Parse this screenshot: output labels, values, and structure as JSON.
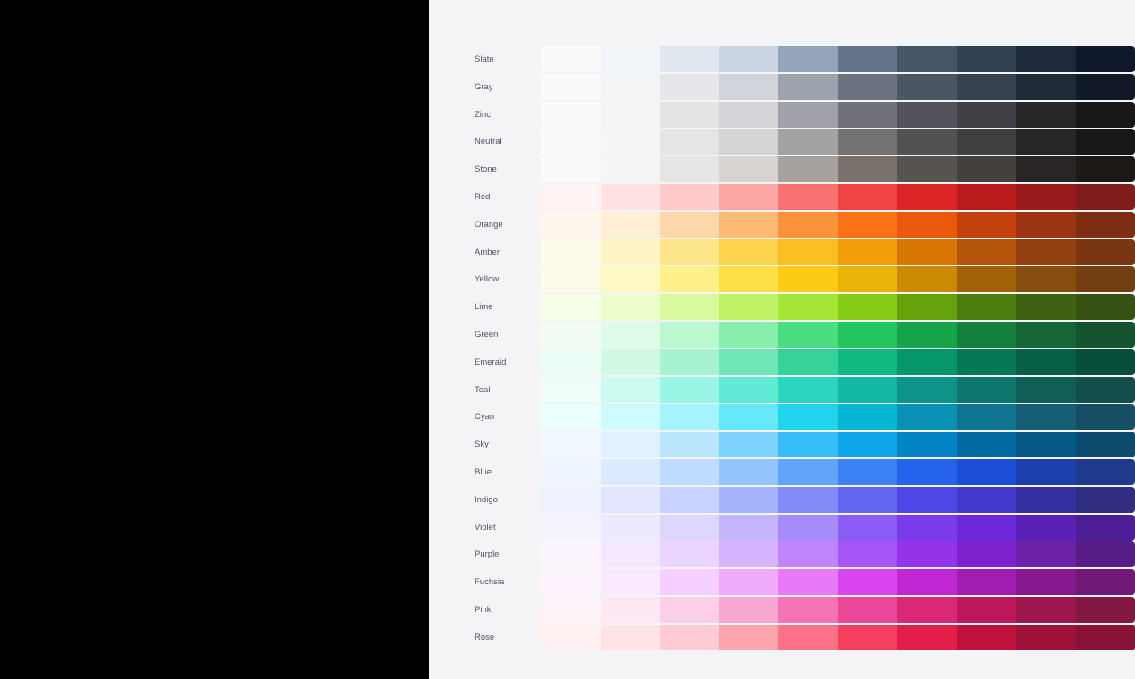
{
  "palette": {
    "rows": [
      {
        "name": "Slate",
        "colors": [
          "#f8fafc",
          "#f1f5f9",
          "#e2e8f0",
          "#cbd5e1",
          "#94a3b8",
          "#64748b",
          "#475569",
          "#334155",
          "#1e293b",
          "#0f172a"
        ]
      },
      {
        "name": "Gray",
        "colors": [
          "#f9fafb",
          "#f3f4f6",
          "#e5e7eb",
          "#d1d5db",
          "#9ca3af",
          "#6b7280",
          "#4b5563",
          "#374151",
          "#1f2937",
          "#111827"
        ]
      },
      {
        "name": "Zinc",
        "colors": [
          "#fafafa",
          "#f4f4f5",
          "#e4e4e7",
          "#d4d4d8",
          "#a1a1aa",
          "#71717a",
          "#52525b",
          "#3f3f46",
          "#27272a",
          "#18181b"
        ]
      },
      {
        "name": "Neutral",
        "colors": [
          "#fafafa",
          "#f5f5f5",
          "#e5e5e5",
          "#d4d4d4",
          "#a3a3a3",
          "#737373",
          "#525252",
          "#404040",
          "#262626",
          "#171717"
        ]
      },
      {
        "name": "Stone",
        "colors": [
          "#fafaf9",
          "#f5f5f4",
          "#e7e5e4",
          "#d6d3d1",
          "#a8a29e",
          "#78716c",
          "#57534e",
          "#44403c",
          "#292524",
          "#1c1917"
        ]
      },
      {
        "name": "Red",
        "colors": [
          "#fef2f2",
          "#fee2e2",
          "#fecaca",
          "#fca5a5",
          "#f87171",
          "#ef4444",
          "#dc2626",
          "#b91c1c",
          "#991b1b",
          "#7f1d1d"
        ]
      },
      {
        "name": "Orange",
        "colors": [
          "#fff7ed",
          "#ffedd5",
          "#fed7aa",
          "#fdba74",
          "#fb923c",
          "#f97316",
          "#ea580c",
          "#c2410c",
          "#9a3412",
          "#7c2d12"
        ]
      },
      {
        "name": "Amber",
        "colors": [
          "#fffbeb",
          "#fef3c7",
          "#fde68a",
          "#fcd34d",
          "#fbbf24",
          "#f59e0b",
          "#d97706",
          "#b45309",
          "#92400e",
          "#78350f"
        ]
      },
      {
        "name": "Yellow",
        "colors": [
          "#fefce8",
          "#fef9c3",
          "#fef08a",
          "#fde047",
          "#facc15",
          "#eab308",
          "#ca8a04",
          "#a16207",
          "#854d0e",
          "#713f12"
        ]
      },
      {
        "name": "Lime",
        "colors": [
          "#f7fee7",
          "#ecfccb",
          "#d9f99d",
          "#bef264",
          "#a3e635",
          "#84cc16",
          "#65a30d",
          "#4d7c0f",
          "#3f6212",
          "#365314"
        ]
      },
      {
        "name": "Green",
        "colors": [
          "#f0fdf4",
          "#dcfce7",
          "#bbf7d0",
          "#86efac",
          "#4ade80",
          "#22c55e",
          "#16a34a",
          "#15803d",
          "#166534",
          "#14532d"
        ]
      },
      {
        "name": "Emerald",
        "colors": [
          "#ecfdf5",
          "#d1fae5",
          "#a7f3d0",
          "#6ee7b7",
          "#34d399",
          "#10b981",
          "#059669",
          "#047857",
          "#065f46",
          "#064e3b"
        ]
      },
      {
        "name": "Teal",
        "colors": [
          "#f0fdfa",
          "#ccfbf1",
          "#99f6e4",
          "#5eead4",
          "#2dd4bf",
          "#14b8a6",
          "#0d9488",
          "#0f766e",
          "#115e59",
          "#134e4a"
        ]
      },
      {
        "name": "Cyan",
        "colors": [
          "#ecfeff",
          "#cffafe",
          "#a5f3fc",
          "#67e8f9",
          "#22d3ee",
          "#06b6d4",
          "#0891b2",
          "#0e7490",
          "#155e75",
          "#164e63"
        ]
      },
      {
        "name": "Sky",
        "colors": [
          "#f0f9ff",
          "#e0f2fe",
          "#bae6fd",
          "#7dd3fc",
          "#38bdf8",
          "#0ea5e9",
          "#0284c7",
          "#0369a1",
          "#075985",
          "#0c4a6e"
        ]
      },
      {
        "name": "Blue",
        "colors": [
          "#eff6ff",
          "#dbeafe",
          "#bfdbfe",
          "#93c5fd",
          "#60a5fa",
          "#3b82f6",
          "#2563eb",
          "#1d4ed8",
          "#1e40af",
          "#1e3a8a"
        ]
      },
      {
        "name": "Indigo",
        "colors": [
          "#eef2ff",
          "#e0e7ff",
          "#c7d2fe",
          "#a5b4fc",
          "#818cf8",
          "#6366f1",
          "#4f46e5",
          "#4338ca",
          "#3730a3",
          "#312e81"
        ]
      },
      {
        "name": "Violet",
        "colors": [
          "#f5f3ff",
          "#ede9fe",
          "#ddd6fe",
          "#c4b5fd",
          "#a78bfa",
          "#8b5cf6",
          "#7c3aed",
          "#6d28d9",
          "#5b21b6",
          "#4c1d95"
        ]
      },
      {
        "name": "Purple",
        "colors": [
          "#faf5ff",
          "#f3e8ff",
          "#e9d5ff",
          "#d8b4fe",
          "#c084fc",
          "#a855f7",
          "#9333ea",
          "#7e22ce",
          "#6b21a8",
          "#581c87"
        ]
      },
      {
        "name": "Fuchsia",
        "colors": [
          "#fdf4ff",
          "#fae8ff",
          "#f5d0fe",
          "#f0abfc",
          "#e879f9",
          "#d946ef",
          "#c026d3",
          "#a21caf",
          "#86198f",
          "#701a75"
        ]
      },
      {
        "name": "Pink",
        "colors": [
          "#fdf2f8",
          "#fce7f3",
          "#fbcfe8",
          "#f9a8d4",
          "#f472b6",
          "#ec4899",
          "#db2777",
          "#be185d",
          "#9d174d",
          "#831843"
        ]
      },
      {
        "name": "Rose",
        "colors": [
          "#fff1f2",
          "#ffe4e6",
          "#fecdd3",
          "#fda4af",
          "#fb7185",
          "#f43f5e",
          "#e11d48",
          "#be123c",
          "#9f1239",
          "#881337"
        ]
      }
    ]
  }
}
